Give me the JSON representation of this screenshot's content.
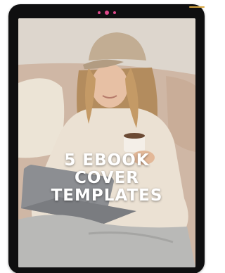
{
  "cover": {
    "title_lines": [
      "5 EBOOK",
      "COVER",
      "TEMPLATES"
    ]
  },
  "device": {
    "frame_color": "#0f0f10",
    "camera_dot_color": "#e0488b",
    "accent_color": "#d7a641"
  },
  "photo": {
    "subject": "woman in beige cap holding coffee mug with laptop",
    "palette": {
      "wall": "#ddd6cd",
      "sofa": "#cfb7a5",
      "cap": "#c2ad93",
      "hair": "#b99262",
      "sweater": "#ece2d5",
      "pants": "#b9b9b7",
      "laptop": "#8a8c90",
      "skin": "#e7c0a4"
    }
  }
}
